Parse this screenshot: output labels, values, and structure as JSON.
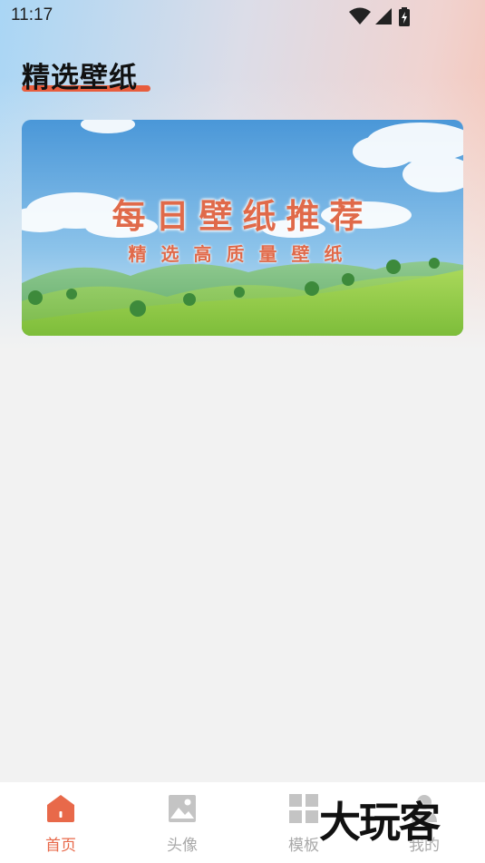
{
  "status_bar": {
    "time": "11:17"
  },
  "header": {
    "title": "精选壁纸",
    "accent_color": "#e85d3d"
  },
  "banner": {
    "title": "每日壁纸推荐",
    "subtitle": "精选高质量壁纸"
  },
  "bottom_nav": {
    "active_color": "#e8694a",
    "inactive_color": "#a9a9a9",
    "items": [
      {
        "label": "首页",
        "icon": "home-icon",
        "active": true
      },
      {
        "label": "头像",
        "icon": "image-icon",
        "active": false
      },
      {
        "label": "模板",
        "icon": "grid-icon",
        "active": false
      },
      {
        "label": "我的",
        "icon": "profile-icon",
        "active": false
      }
    ]
  },
  "watermark": {
    "text": "大玩客"
  }
}
